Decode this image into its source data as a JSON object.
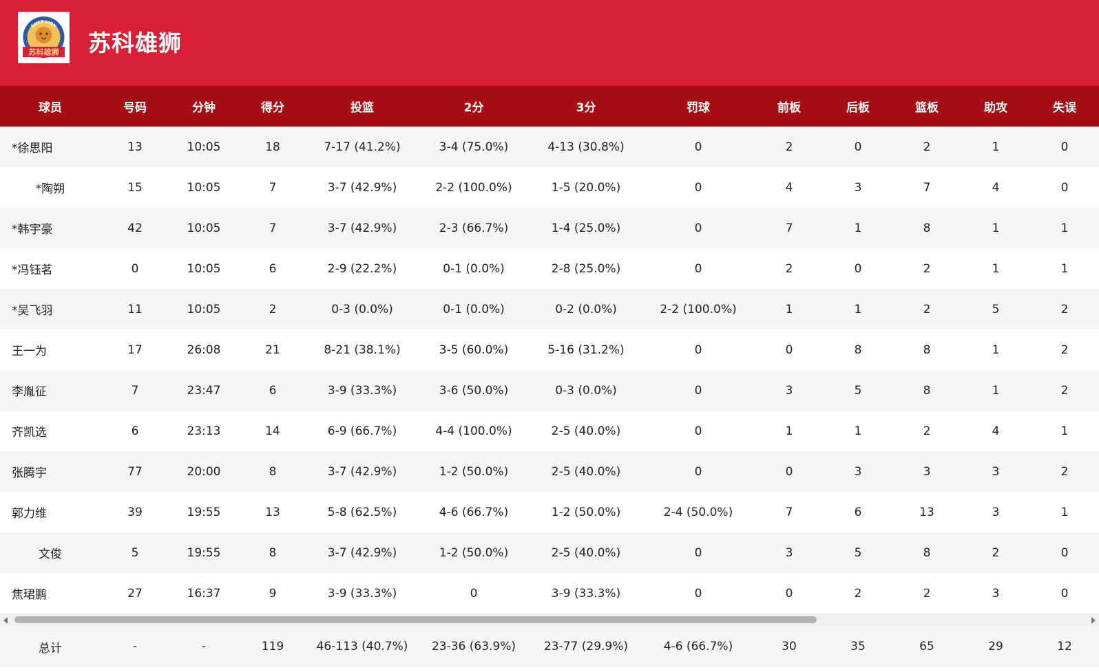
{
  "team": {
    "name": "苏科雄狮",
    "logo_text": "苏科雄狮",
    "logo_arc_text": "SUKE LION"
  },
  "colors": {
    "header_bg": "#d91f35",
    "table_header_bg": "#a50e12"
  },
  "columns": [
    "球员",
    "号码",
    "分钟",
    "得分",
    "投篮",
    "2分",
    "3分",
    "罚球",
    "前板",
    "后板",
    "篮板",
    "助攻",
    "失误"
  ],
  "rows": [
    [
      "*徐思阳",
      "13",
      "10:05",
      "18",
      "7-17 (41.2%)",
      "3-4 (75.0%)",
      "4-13 (30.8%)",
      "0",
      "2",
      "0",
      "2",
      "1",
      "0"
    ],
    [
      "*陶朔",
      "15",
      "10:05",
      "7",
      "3-7 (42.9%)",
      "2-2 (100.0%)",
      "1-5 (20.0%)",
      "0",
      "4",
      "3",
      "7",
      "4",
      "0"
    ],
    [
      "*韩宇豪",
      "42",
      "10:05",
      "7",
      "3-7 (42.9%)",
      "2-3 (66.7%)",
      "1-4 (25.0%)",
      "0",
      "7",
      "1",
      "8",
      "1",
      "1"
    ],
    [
      "*冯钰茗",
      "0",
      "10:05",
      "6",
      "2-9 (22.2%)",
      "0-1 (0.0%)",
      "2-8 (25.0%)",
      "0",
      "2",
      "0",
      "2",
      "1",
      "1"
    ],
    [
      "*吴飞羽",
      "11",
      "10:05",
      "2",
      "0-3 (0.0%)",
      "0-1 (0.0%)",
      "0-2 (0.0%)",
      "2-2 (100.0%)",
      "1",
      "1",
      "2",
      "5",
      "2"
    ],
    [
      "王一为",
      "17",
      "26:08",
      "21",
      "8-21 (38.1%)",
      "3-5 (60.0%)",
      "5-16 (31.2%)",
      "0",
      "0",
      "8",
      "8",
      "1",
      "2"
    ],
    [
      "李胤征",
      "7",
      "23:47",
      "6",
      "3-9 (33.3%)",
      "3-6 (50.0%)",
      "0-3 (0.0%)",
      "0",
      "3",
      "5",
      "8",
      "1",
      "2"
    ],
    [
      "齐凯选",
      "6",
      "23:13",
      "14",
      "6-9 (66.7%)",
      "4-4 (100.0%)",
      "2-5 (40.0%)",
      "0",
      "1",
      "1",
      "2",
      "4",
      "1"
    ],
    [
      "张腾宇",
      "77",
      "20:00",
      "8",
      "3-7 (42.9%)",
      "1-2 (50.0%)",
      "2-5 (40.0%)",
      "0",
      "0",
      "3",
      "3",
      "3",
      "2"
    ],
    [
      "郭力维",
      "39",
      "19:55",
      "13",
      "5-8 (62.5%)",
      "4-6 (66.7%)",
      "1-2 (50.0%)",
      "2-4 (50.0%)",
      "7",
      "6",
      "13",
      "3",
      "1"
    ],
    [
      "文俊",
      "5",
      "19:55",
      "8",
      "3-7 (42.9%)",
      "1-2 (50.0%)",
      "2-5 (40.0%)",
      "0",
      "3",
      "5",
      "8",
      "2",
      "0"
    ],
    [
      "焦珺鹏",
      "27",
      "16:37",
      "9",
      "3-9 (33.3%)",
      "0",
      "3-9 (33.3%)",
      "0",
      "0",
      "2",
      "2",
      "3",
      "0"
    ]
  ],
  "totals": [
    "总计",
    "-",
    "-",
    "119",
    "46-113 (40.7%)",
    "23-36 (63.9%)",
    "23-77 (29.9%)",
    "4-6 (66.7%)",
    "30",
    "35",
    "65",
    "29",
    "12"
  ]
}
